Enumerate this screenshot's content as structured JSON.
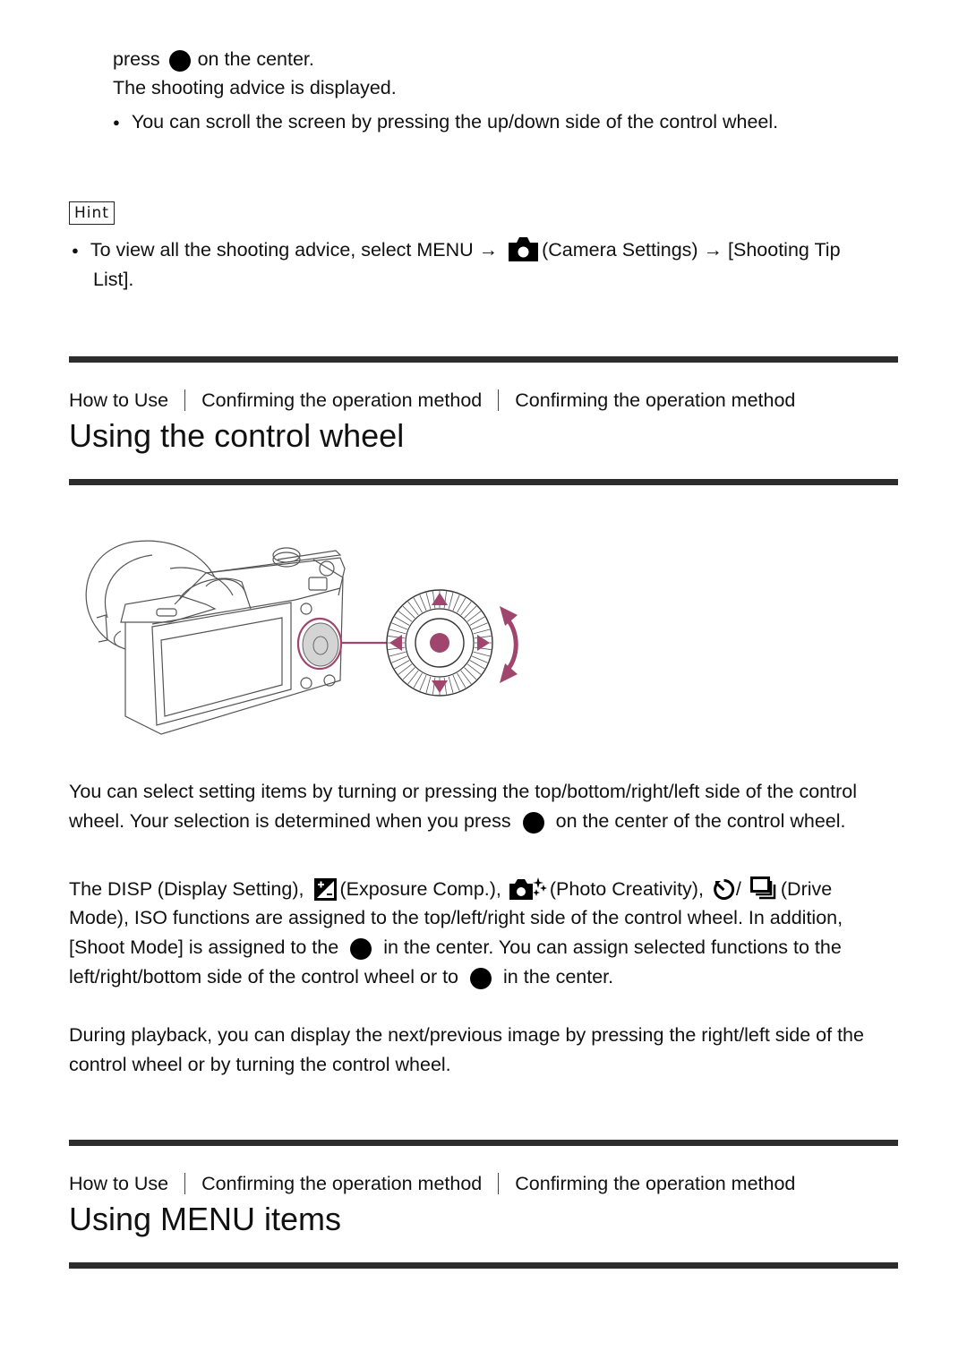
{
  "continued_step": {
    "line1_pre": "press",
    "line1_post": "on the center.",
    "line2": "The shooting advice is displayed.",
    "bullet": "You can scroll the screen by pressing the up/down side of the control wheel."
  },
  "hint": {
    "label": "Hint",
    "bullet_pre": "To view all the shooting advice, select MENU →",
    "bullet_mid": "(Camera Settings) → [Shooting Tip",
    "bullet_line2": "List]."
  },
  "section1": {
    "breadcrumb": [
      "How to Use",
      "Confirming the operation method",
      "Confirming the operation method"
    ],
    "title": "Using the control wheel",
    "figure": {
      "accent_color": "#a0466e",
      "description": "Camera back with control wheel highlighted"
    },
    "para1": {
      "line1": "You can select setting items by turning or pressing the top/bottom/right/left side of the control",
      "line2_pre": "wheel. Your selection is determined when you press",
      "line2_post": "on the center of the control wheel."
    },
    "para2": {
      "line1_a": "The DISP (Display Setting),",
      "line1_b": "(Exposure Comp.),",
      "line1_c": "(Photo Creativity),",
      "line1_d": "/",
      "line1_e": "(Drive",
      "line2": "Mode), ISO functions are assigned to the top/left/right side of the control wheel. In addition,",
      "line3_pre": "[Shoot Mode] is assigned to the",
      "line3_post": "in the center. You can assign selected functions to the",
      "line4_pre": "left/right/bottom side of the control wheel or to",
      "line4_post": "in the center."
    },
    "para3": {
      "line1": "During playback, you can display the next/previous image by pressing the right/left side of the",
      "line2": "control wheel or by turning the control wheel."
    }
  },
  "section2": {
    "breadcrumb": [
      "How to Use",
      "Confirming the operation method",
      "Confirming the operation method"
    ],
    "title": "Using MENU items"
  }
}
